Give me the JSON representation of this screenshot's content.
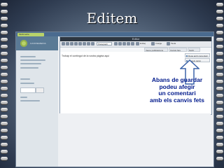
{
  "slide": {
    "title": "Editem",
    "note_lines": [
      "Abans de guardar",
      "podeu afegir",
      "un comentari",
      "amb els canvis fets"
    ]
  },
  "app": {
    "tab_label": "Multimedia",
    "logo_text": "CANVIEMEDIA"
  },
  "editor": {
    "window_title": "Editor",
    "style_select": "Paragraph",
    "toolbar_labels": [
      "Enllaç",
      "Imatge",
      "Taula"
    ],
    "tabs": [
      "Veure publicacions",
      "Canvis fets",
      "Sortir"
    ],
    "body_text": "Trobap el contingut de la vostra pàgina aquí",
    "panel_buttons": [
      "Desa amb comentari",
      "Afegeix canvi"
    ]
  },
  "colors": {
    "note": "#001a8c",
    "arrow_fill": "#ffffff",
    "arrow_stroke": "#3b63a8"
  }
}
